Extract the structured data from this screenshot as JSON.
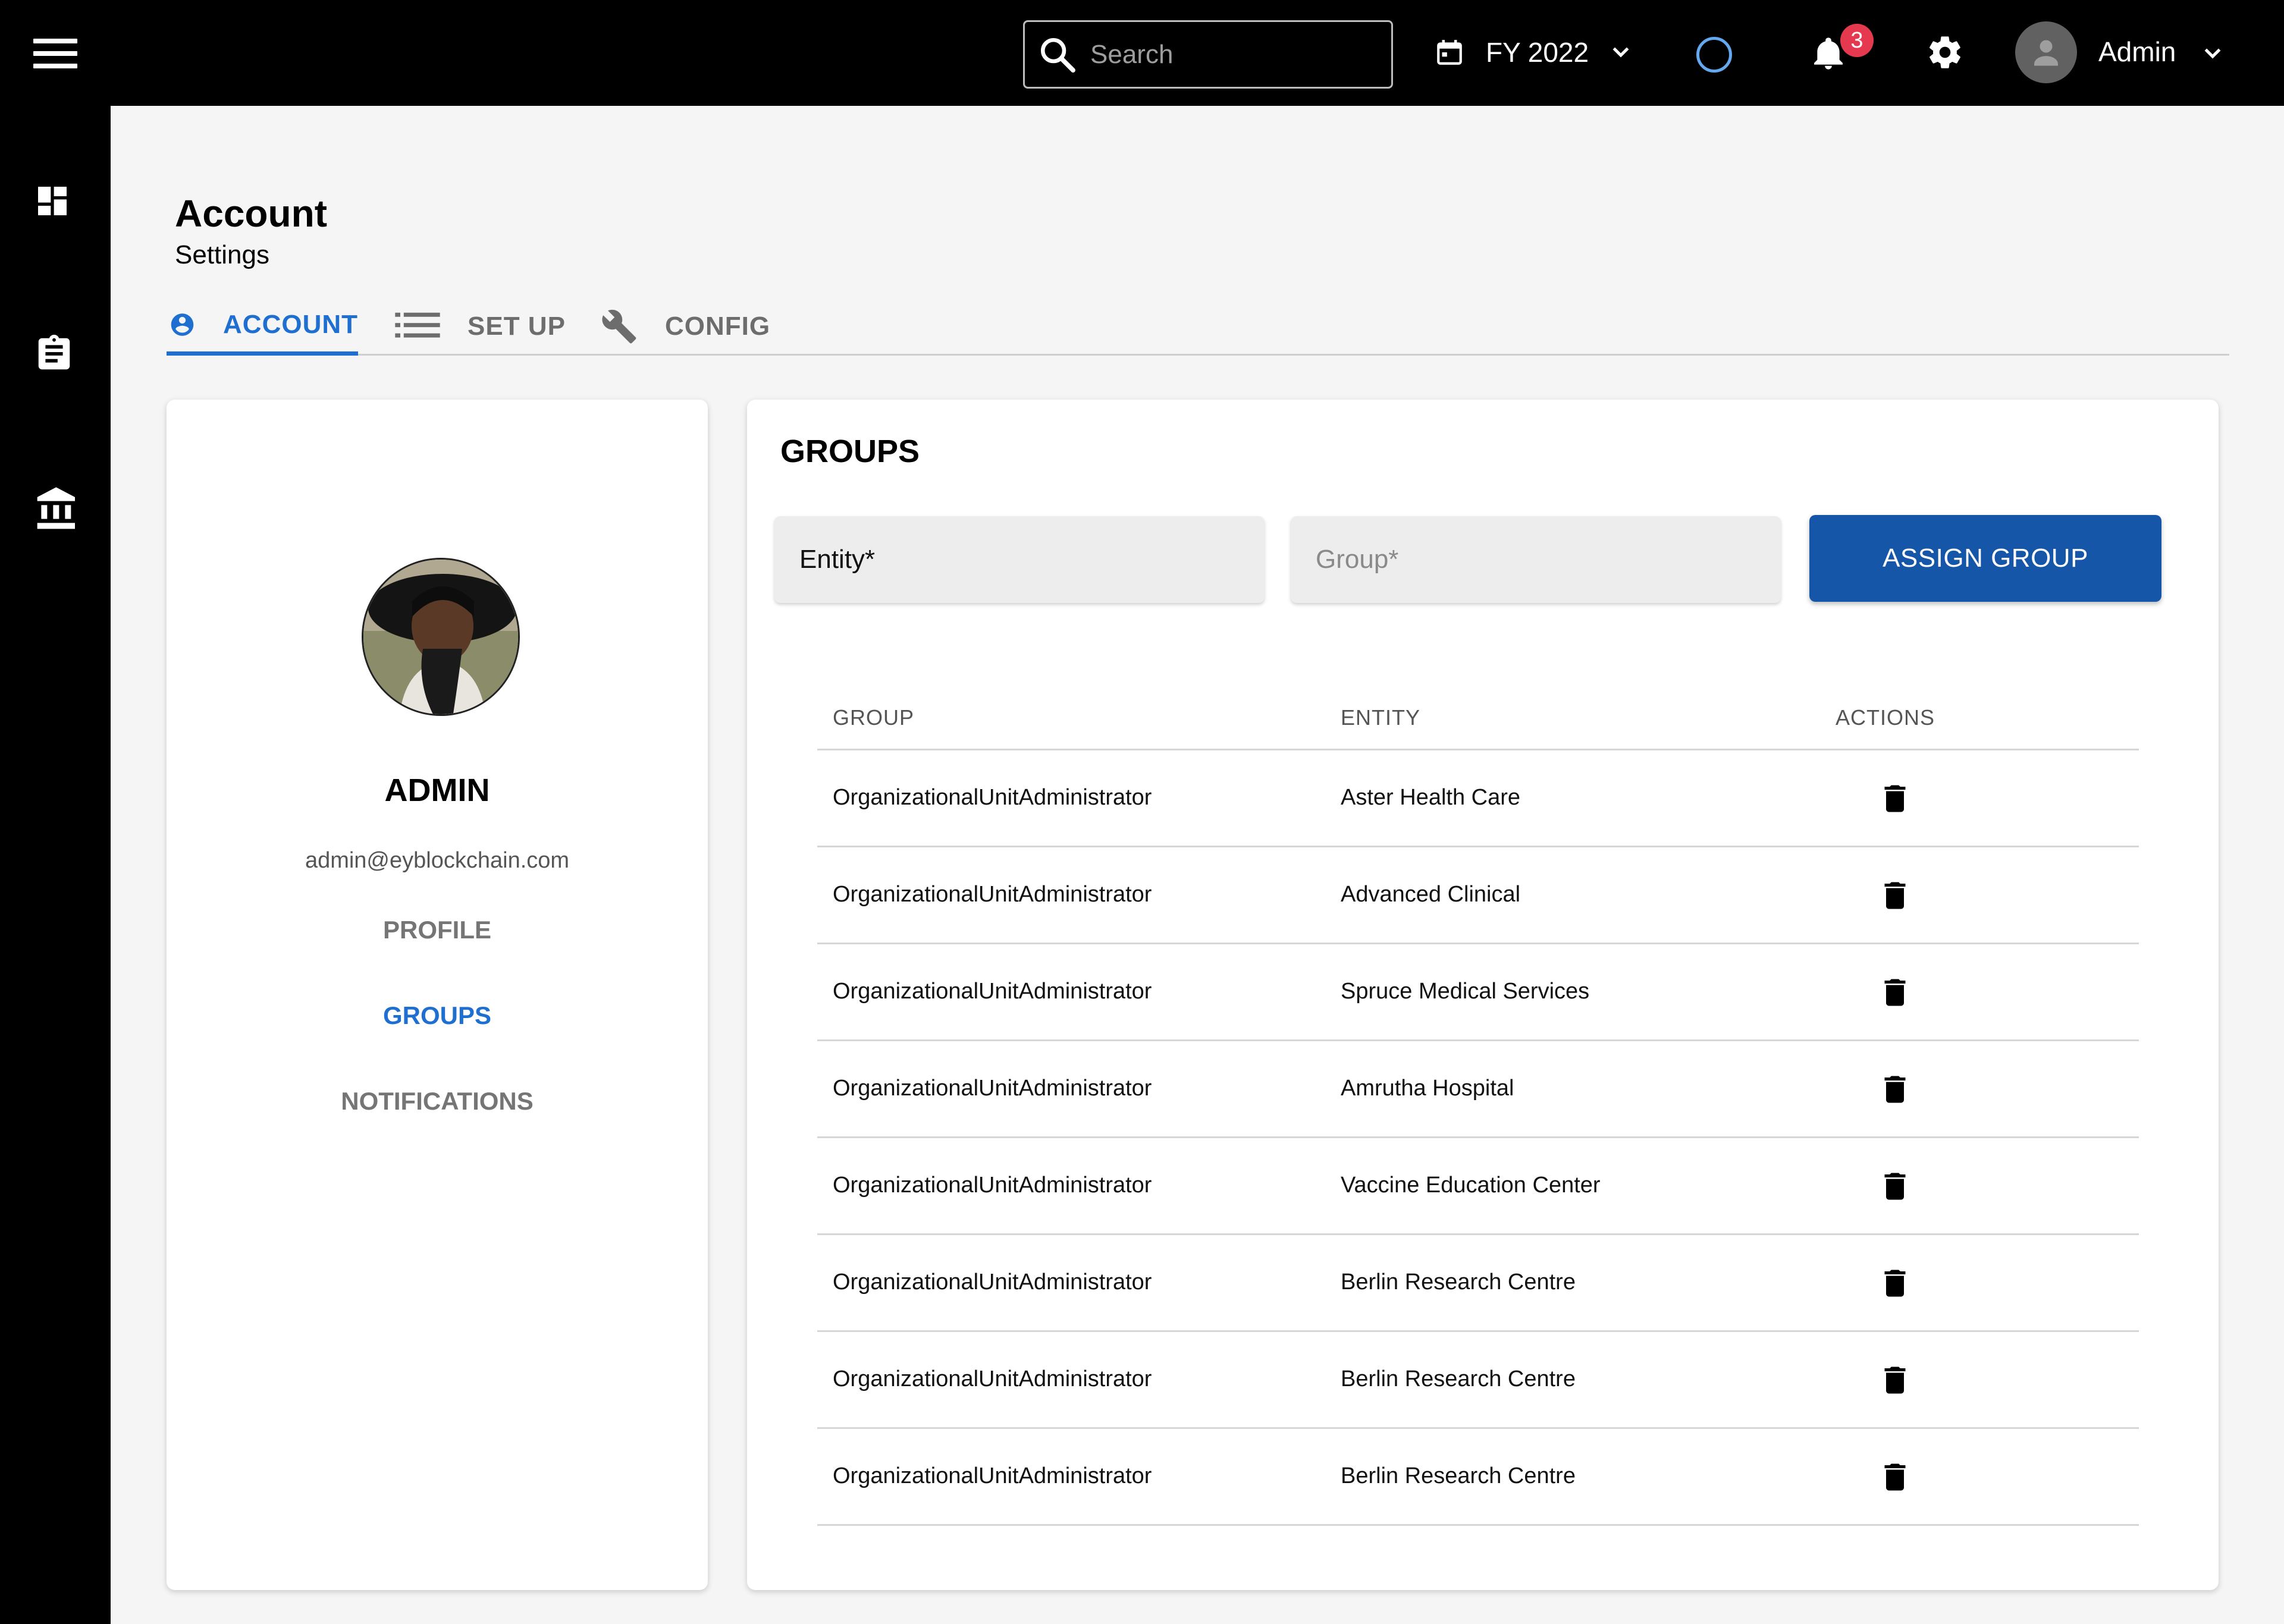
{
  "topbar": {
    "search_placeholder": "Search",
    "fiscal_year": "FY 2022",
    "notification_count": "3",
    "user_name": "Admin",
    "accent_ring_color": "#64a8f0",
    "badge_color": "#e53950"
  },
  "rail": {
    "icons": [
      "dashboard-icon",
      "clipboard-icon",
      "institution-icon"
    ]
  },
  "header": {
    "title": "Account",
    "subtitle": "Settings"
  },
  "tabs": [
    {
      "label": "ACCOUNT",
      "icon": "account-circle-icon",
      "active": true
    },
    {
      "label": "SET UP",
      "icon": "list-icon",
      "active": false
    },
    {
      "label": "CONFIG",
      "icon": "wrench-icon",
      "active": false
    }
  ],
  "profile": {
    "name": "ADMIN",
    "email": "admin@eyblockchain.com",
    "links": [
      {
        "label": "PROFILE",
        "active": false
      },
      {
        "label": "GROUPS",
        "active": true
      },
      {
        "label": "NOTIFICATIONS",
        "active": false
      }
    ]
  },
  "groups": {
    "title": "GROUPS",
    "entity_label": "Entity*",
    "group_placeholder": "Group*",
    "assign_button": "ASSIGN GROUP",
    "columns": [
      "GROUP",
      "ENTITY",
      "ACTIONS"
    ],
    "rows": [
      {
        "group": "OrganizationalUnitAdministrator",
        "entity": "Aster Health Care"
      },
      {
        "group": "OrganizationalUnitAdministrator",
        "entity": "Advanced Clinical"
      },
      {
        "group": "OrganizationalUnitAdministrator",
        "entity": "Spruce Medical Services"
      },
      {
        "group": "OrganizationalUnitAdministrator",
        "entity": "Amrutha Hospital"
      },
      {
        "group": "OrganizationalUnitAdministrator",
        "entity": "Vaccine Education Center"
      },
      {
        "group": "OrganizationalUnitAdministrator",
        "entity": "Berlin Research Centre"
      },
      {
        "group": "OrganizationalUnitAdministrator",
        "entity": "Berlin Research Centre"
      },
      {
        "group": "OrganizationalUnitAdministrator",
        "entity": "Berlin Research Centre"
      }
    ]
  },
  "colors": {
    "primary": "#1e6fd0",
    "button": "#1656a8"
  }
}
